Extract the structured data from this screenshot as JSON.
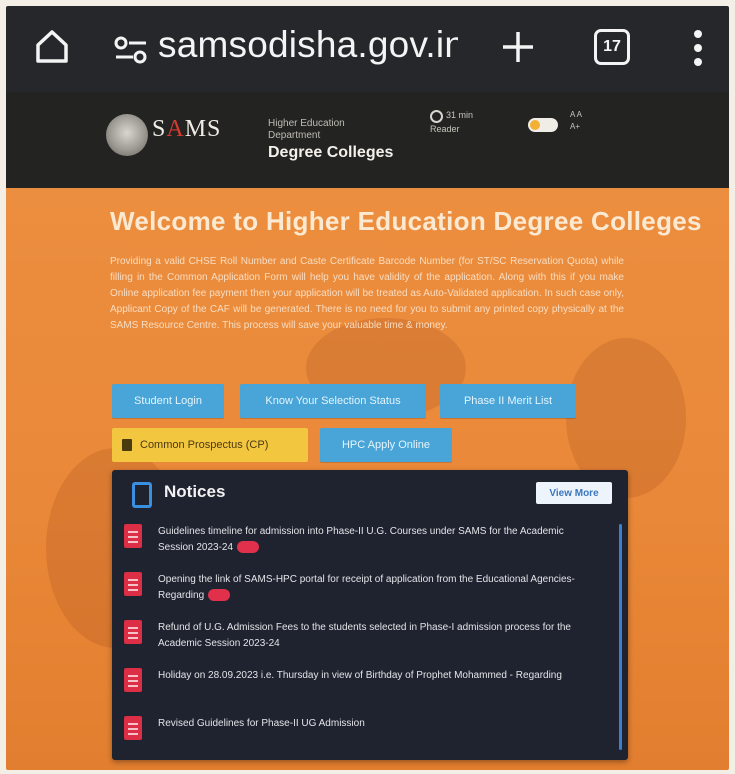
{
  "browser": {
    "url": "samsodisha.gov.in/De",
    "tab_count": "17",
    "icons": [
      "home-icon",
      "tune-icon",
      "plus-icon",
      "more-icon"
    ]
  },
  "header": {
    "logo_text_red": "A",
    "logo_text_left": "S",
    "logo_text_right": "MS",
    "subtitle_line1": "Higher Education",
    "subtitle_line2": "Department",
    "title": "Degree Colleges",
    "timer_label": "31 min",
    "reader_label": "Reader",
    "lang_1": "A  A",
    "lang_2": "A+"
  },
  "main": {
    "title": "Welcome to Higher Education Degree Colleges",
    "intro": "Providing a valid CHSE Roll Number and Caste Certificate Barcode Number (for ST/SC Reservation Quota) while filling in the Common Application Form will help you have validity of the application. Along with this if you make Online application fee payment then your application will be treated as Auto-Validated application. In such case only, Applicant Copy of the CAF will be generated. There is no need for you to submit any printed copy physically at the SAMS Resource Centre. This process will save your valuable time & money.",
    "buttons": {
      "student_login": "Student Login",
      "selection_status": "Know Your Selection Status",
      "phase_merit": "Phase II Merit List",
      "prospectus": "Common Prospectus (CP)",
      "hpc_apply": "HPC Apply Online"
    }
  },
  "notices": {
    "title": "Notices",
    "view_more": "View More",
    "items": [
      {
        "text": "Guidelines timeline for admission into Phase-II U.G. Courses under SAMS for the Academic Session 2023-24"
      },
      {
        "text": "Opening the link of SAMS-HPC portal for receipt of application from the Educational Agencies-Regarding"
      },
      {
        "text": "Refund of U.G. Admission Fees to the students selected in Phase-I admission process for the Academic Session 2023-24"
      },
      {
        "text": "Holiday on 28.09.2023 i.e. Thursday in view of Birthday of Prophet Mohammed - Regarding"
      },
      {
        "text": "Revised Guidelines for Phase-II UG Admission"
      }
    ]
  },
  "colors": {
    "browser_bar": "#25272b",
    "header_bg": "#232322",
    "main_orange": "#ec8e3f",
    "button_blue": "#49a5d8",
    "button_yellow": "#f3c640",
    "notices_bg": "#1f2330",
    "pdf_red": "#dc2e45"
  }
}
